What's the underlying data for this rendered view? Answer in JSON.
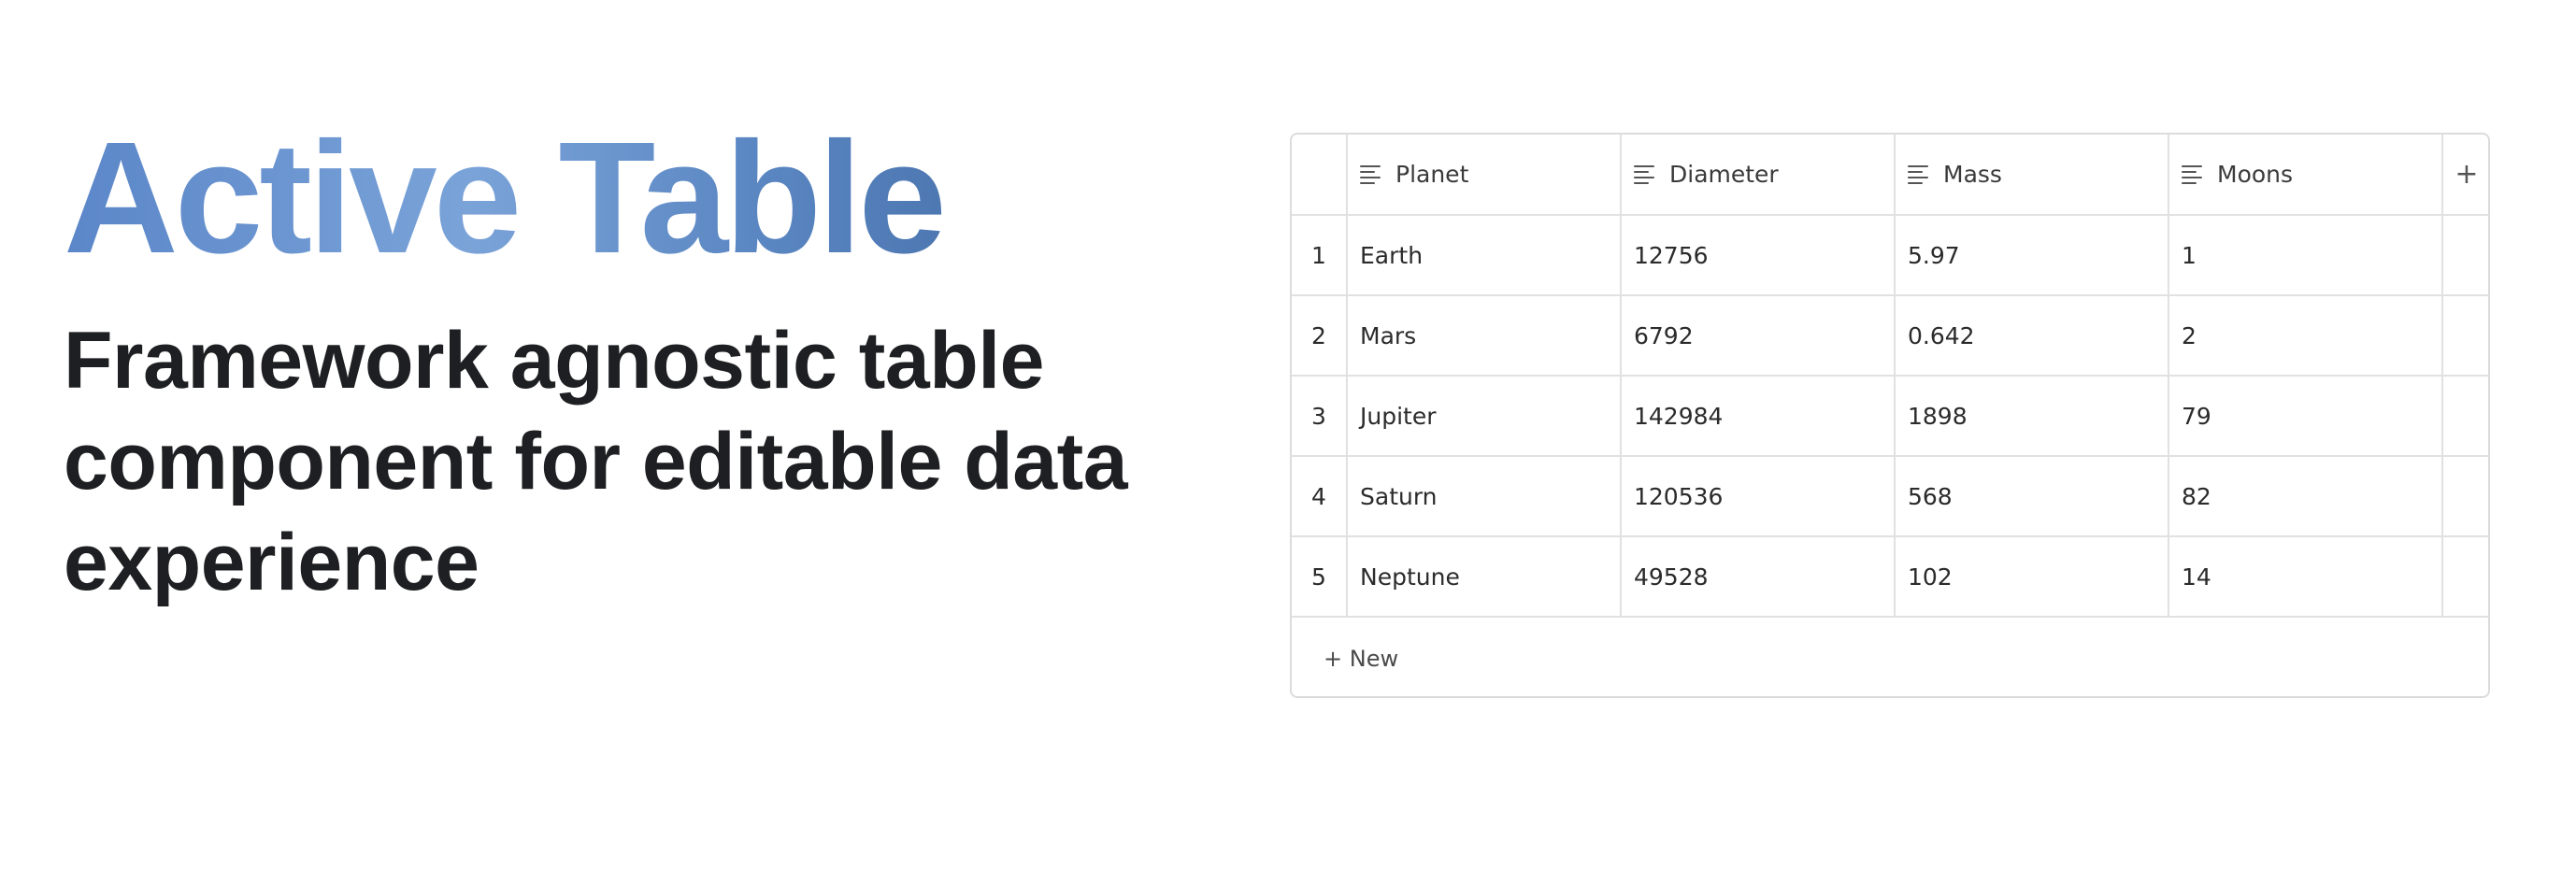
{
  "hero": {
    "title": "Active Table",
    "subtitle": "Framework agnostic table component for editable data experience"
  },
  "table": {
    "columns": [
      "Planet",
      "Diameter",
      "Mass",
      "Moons"
    ],
    "add_column_label": "+",
    "rows": [
      {
        "index": "1",
        "cells": [
          "Earth",
          "12756",
          "5.97",
          "1"
        ]
      },
      {
        "index": "2",
        "cells": [
          "Mars",
          "6792",
          "0.642",
          "2"
        ]
      },
      {
        "index": "3",
        "cells": [
          "Jupiter",
          "142984",
          "1898",
          "79"
        ]
      },
      {
        "index": "4",
        "cells": [
          "Saturn",
          "120536",
          "568",
          "82"
        ]
      },
      {
        "index": "5",
        "cells": [
          "Neptune",
          "49528",
          "102",
          "14"
        ]
      }
    ],
    "new_row_label": "+ New",
    "column_icon": "text-lines-icon"
  },
  "colors": {
    "title_gradient_start": "#5b86c8",
    "title_gradient_end": "#3a6299",
    "text": "#1e1f22",
    "border": "#dcdcdc"
  }
}
